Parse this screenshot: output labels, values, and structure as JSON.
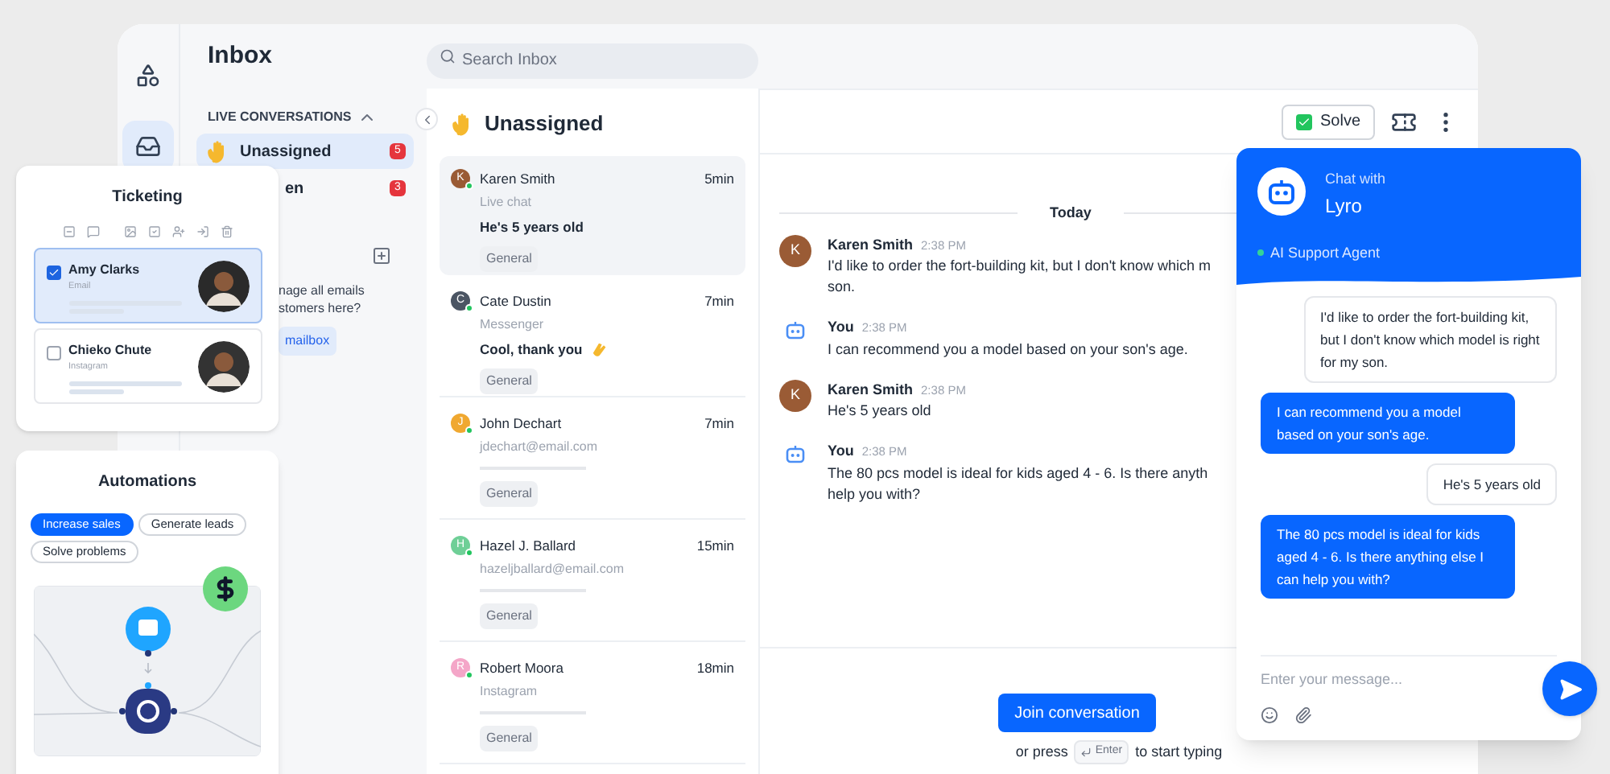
{
  "app": {
    "title": "Inbox",
    "search": {
      "placeholder": "Search Inbox"
    }
  },
  "rail_items": [
    {
      "kind": "shapes",
      "selected": false
    },
    {
      "kind": "inbox",
      "selected": true
    }
  ],
  "sidebar": {
    "section": "LIVE CONVERSATIONS",
    "expanded": true,
    "items": [
      {
        "label": "Unassigned",
        "count": "5",
        "selected": true
      },
      {
        "label": "en",
        "count": "3",
        "selected": false
      }
    ],
    "promo": {
      "lines": [
        "nage all emails",
        "stomers here?"
      ],
      "button": "mailbox"
    }
  },
  "list": {
    "title": "Unassigned",
    "conversations": [
      {
        "name": "Karen Smith",
        "initial": "K",
        "color": "#9a5b35",
        "channel": "Live chat",
        "preview": "He's 5 years old",
        "time": "5min",
        "tag": "General",
        "selected": true,
        "kind": "message",
        "clap": false
      },
      {
        "name": "Cate Dustin",
        "initial": "C",
        "color": "#4b5563",
        "channel": "Messenger",
        "preview": "Cool, thank you",
        "time": "7min",
        "tag": "General",
        "selected": false,
        "kind": "message",
        "clap": true
      },
      {
        "name": "John Dechart",
        "initial": "J",
        "color": "#f0a830",
        "channel": "jdechart@email.com",
        "time": "7min",
        "tag": "General",
        "selected": false,
        "kind": "placeholder"
      },
      {
        "name": "Hazel J. Ballard",
        "initial": "H",
        "color": "#6fcf97",
        "channel": "hazeljballard@email.com",
        "time": "15min",
        "tag": "General",
        "selected": false,
        "kind": "placeholder"
      },
      {
        "name": "Robert Moora",
        "initial": "R",
        "color": "#f4a6c8",
        "channel": "Instagram",
        "time": "18min",
        "tag": "General",
        "selected": false,
        "kind": "placeholder"
      }
    ]
  },
  "chat": {
    "solve": "Solve",
    "date": "Today",
    "messages": [
      {
        "kind": "customer",
        "author": "Karen Smith",
        "initial": "K",
        "time": "2:38 PM",
        "lines": [
          "I'd like to order the fort-building kit, but I don't know which m",
          "son."
        ]
      },
      {
        "kind": "bot",
        "author": "You",
        "time": "2:38 PM",
        "lines": [
          "I can recommend you a model based on your son's age."
        ]
      },
      {
        "kind": "customer",
        "author": "Karen Smith",
        "initial": "K",
        "time": "2:38 PM",
        "lines": [
          "He's 5 years old"
        ]
      },
      {
        "kind": "bot",
        "author": "You",
        "time": "2:38 PM",
        "lines": [
          "The 80 pcs model is ideal for kids aged 4 - 6. Is there anyth",
          "help you with?"
        ]
      }
    ],
    "join": "Join conversation",
    "hint_before": "or press",
    "key": "Enter",
    "hint_after": "to start typing"
  },
  "ticketing": {
    "title": "Ticketing",
    "tickets": [
      {
        "name": "Amy Clarks",
        "channel": "Email",
        "checked": true,
        "selected": true
      },
      {
        "name": "Chieko Chute",
        "channel": "Instagram",
        "checked": false,
        "selected": false
      }
    ]
  },
  "automations": {
    "title": "Automations",
    "chips": [
      {
        "label": "Increase sales",
        "selected": true
      },
      {
        "label": "Generate leads",
        "selected": false
      },
      {
        "label": "Solve problems",
        "selected": false
      }
    ]
  },
  "widget": {
    "caption": "Chat with",
    "name": "Lyro",
    "status": "AI Support Agent",
    "online": true,
    "messages": [
      {
        "kind": "user",
        "text": "I'd like to order the fort-building kit, but I don't know which model is right for my son."
      },
      {
        "kind": "bot",
        "text": "I can recommend you a model based on your son's age."
      },
      {
        "kind": "user",
        "text": "He's 5 years old"
      },
      {
        "kind": "bot",
        "text": "The 80 pcs model is ideal for kids aged 4 - 6. Is there anything else I can help you with?"
      }
    ],
    "placeholder": "Enter your message..."
  }
}
